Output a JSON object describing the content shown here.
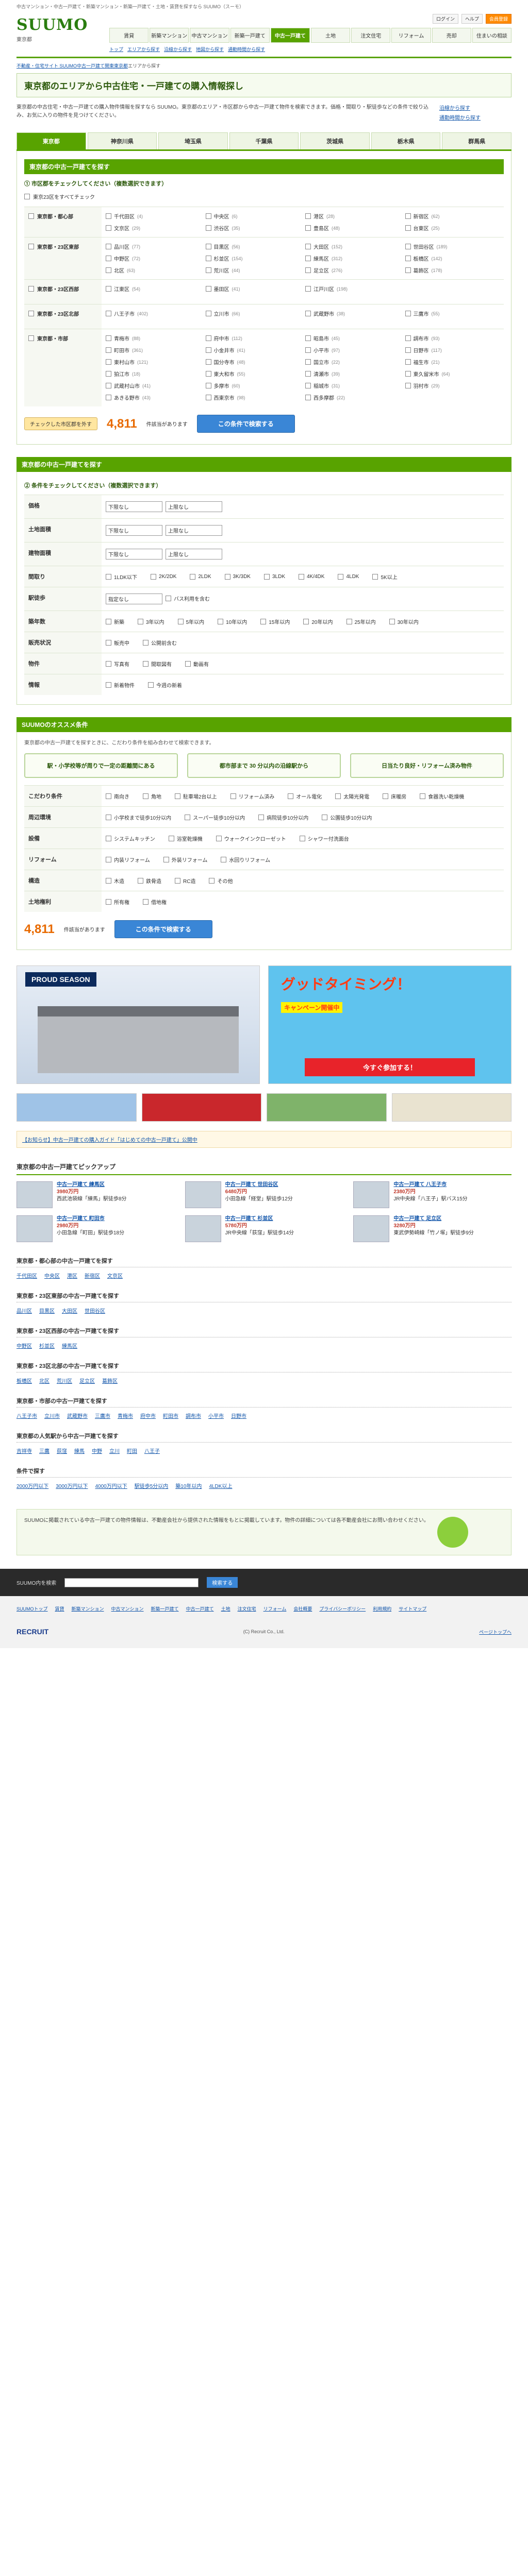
{
  "topline": "中古マンション・中古一戸建て・新築マンション・新築一戸建て・土地・賃貸を探すなら SUUMO（スーモ）",
  "logo": {
    "brand": "SUUMO",
    "sub": "東京都"
  },
  "util": [
    "ログイン",
    "ヘルプ",
    "会員登録"
  ],
  "gnav": [
    "賃貸",
    "新築マンション",
    "中古マンション",
    "新築一戸建て",
    "中古一戸建て",
    "土地",
    "注文住宅",
    "リフォーム",
    "売却",
    "住まいの相談"
  ],
  "gnav_active": 4,
  "subnav": [
    "トップ",
    "エリアから探す",
    "沿線から探す",
    "地図から探す",
    "通勤時間から探す"
  ],
  "breadcrumb": [
    "不動産・住宅サイト SUUMO",
    "中古一戸建て",
    "関東",
    "東京都",
    "エリアから探す"
  ],
  "title": "東京都のエリアから中古住宅・一戸建ての購入情報探し",
  "intro": "東京都の中古住宅・中古一戸建ての購入物件情報を探すなら SUUMO。東京都のエリア・市区郡から中古一戸建て物件を検索できます。価格・間取り・駅徒歩などの条件で絞り込み、お気に入りの物件を見つけてください。",
  "side_links": [
    "沿線から探す",
    "通勤時間から探す"
  ],
  "tabs": [
    "東京都",
    "神奈川県",
    "埼玉県",
    "千葉県",
    "茨城県",
    "栃木県",
    "群馬県"
  ],
  "area_head": "東京都の中古一戸建てを探す",
  "area_step": "① 市区郡をチェックしてください（複数選択できます）",
  "check_all": "東京23区をすべてチェック",
  "regions": [
    {
      "name": "東京都・都心部",
      "items": [
        [
          "千代田区",
          "(4)"
        ],
        [
          "中央区",
          "(6)"
        ],
        [
          "港区",
          "(28)"
        ],
        [
          "新宿区",
          "(62)"
        ],
        [
          "文京区",
          "(29)"
        ],
        [
          "渋谷区",
          "(35)"
        ],
        [
          "豊島区",
          "(48)"
        ],
        [
          "台東区",
          "(25)"
        ]
      ]
    },
    {
      "name": "東京都・23区東部",
      "items": [
        [
          "品川区",
          "(77)"
        ],
        [
          "目黒区",
          "(56)"
        ],
        [
          "大田区",
          "(152)"
        ],
        [
          "世田谷区",
          "(189)"
        ],
        [
          "中野区",
          "(72)"
        ],
        [
          "杉並区",
          "(154)"
        ],
        [
          "練馬区",
          "(312)"
        ],
        [
          "板橋区",
          "(142)"
        ],
        [
          "北区",
          "(63)"
        ],
        [
          "荒川区",
          "(44)"
        ],
        [
          "足立区",
          "(276)"
        ],
        [
          "葛飾区",
          "(178)"
        ]
      ]
    },
    {
      "name": "東京都・23区西部",
      "items": [
        [
          "江東区",
          "(54)"
        ],
        [
          "墨田区",
          "(41)"
        ],
        [
          "江戸川区",
          "(198)"
        ]
      ]
    },
    {
      "name": "東京都・23区北部",
      "items": [
        [
          "八王子市",
          "(402)"
        ],
        [
          "立川市",
          "(66)"
        ],
        [
          "武蔵野市",
          "(38)"
        ],
        [
          "三鷹市",
          "(55)"
        ]
      ]
    },
    {
      "name": "東京都・市部",
      "items": [
        [
          "青梅市",
          "(88)"
        ],
        [
          "府中市",
          "(112)"
        ],
        [
          "昭島市",
          "(45)"
        ],
        [
          "調布市",
          "(93)"
        ],
        [
          "町田市",
          "(361)"
        ],
        [
          "小金井市",
          "(41)"
        ],
        [
          "小平市",
          "(97)"
        ],
        [
          "日野市",
          "(117)"
        ],
        [
          "東村山市",
          "(121)"
        ],
        [
          "国分寺市",
          "(48)"
        ],
        [
          "国立市",
          "(22)"
        ],
        [
          "福生市",
          "(21)"
        ],
        [
          "狛江市",
          "(18)"
        ],
        [
          "東大和市",
          "(55)"
        ],
        [
          "清瀬市",
          "(39)"
        ],
        [
          "東久留米市",
          "(64)"
        ],
        [
          "武蔵村山市",
          "(41)"
        ],
        [
          "多摩市",
          "(60)"
        ],
        [
          "稲城市",
          "(31)"
        ],
        [
          "羽村市",
          "(29)"
        ],
        [
          "あきる野市",
          "(43)"
        ],
        [
          "西東京市",
          "(98)"
        ],
        [
          "西多摩郡",
          "(22)"
        ]
      ]
    }
  ],
  "count_all": "4,811",
  "count_label": "件該当があります",
  "search_btn": "この条件で検索する",
  "clear_btn": "チェックした市区郡を外す",
  "cond_head": "東京都の中古一戸建てを探す",
  "cond_step": "② 条件をチェックしてください（複数選択できます）",
  "conditions": [
    {
      "label": "価格",
      "selects": [
        "下限なし",
        "上限なし"
      ]
    },
    {
      "label": "土地面積",
      "selects": [
        "下限なし",
        "上限なし"
      ]
    },
    {
      "label": "建物面積",
      "selects": [
        "下限なし",
        "上限なし"
      ]
    },
    {
      "label": "間取り",
      "opts": [
        "1LDK以下",
        "2K/2DK",
        "2LDK",
        "3K/3DK",
        "3LDK",
        "4K/4DK",
        "4LDK",
        "5K以上"
      ]
    },
    {
      "label": "駅徒歩",
      "selects": [
        "指定なし"
      ],
      "opts": [
        "バス利用を含む"
      ]
    },
    {
      "label": "築年数",
      "opts": [
        "新築",
        "3年以内",
        "5年以内",
        "10年以内",
        "15年以内",
        "20年以内",
        "25年以内",
        "30年以内"
      ]
    },
    {
      "label": "販売状況",
      "opts": [
        "販売中",
        "公開前含む"
      ]
    },
    {
      "label": "物件",
      "opts": [
        "写真有",
        "間取図有",
        "動画有"
      ]
    },
    {
      "label": "情報",
      "opts": [
        "新着物件",
        "今週の新着"
      ]
    }
  ],
  "features_head": "SUUMOのオススメ条件",
  "features_note": "東京都の中古一戸建てを探すときに、こだわり条件を組み合わせて検索できます。",
  "features": [
    "駅・小学校等が周りで一定の距離間にある",
    "都市部まで 30 分以内の沿線駅から",
    "日当たり良好・リフォーム済み物件"
  ],
  "more_conditions": [
    {
      "label": "こだわり条件",
      "opts": [
        "南向き",
        "角地",
        "駐車場2台以上",
        "リフォーム済み",
        "オール電化",
        "太陽光発電",
        "床暖房",
        "食器洗い乾燥機"
      ]
    },
    {
      "label": "周辺環境",
      "opts": [
        "小学校まで徒歩10分以内",
        "スーパー徒歩10分以内",
        "病院徒歩10分以内",
        "公園徒歩10分以内"
      ]
    },
    {
      "label": "設備",
      "opts": [
        "システムキッチン",
        "浴室乾燥機",
        "ウォークインクローゼット",
        "シャワー付洗面台"
      ]
    },
    {
      "label": "リフォーム",
      "opts": [
        "内装リフォーム",
        "外装リフォーム",
        "水回りリフォーム"
      ]
    },
    {
      "label": "構造",
      "opts": [
        "木造",
        "鉄骨造",
        "RC造",
        "その他"
      ]
    },
    {
      "label": "土地権利",
      "opts": [
        "所有権",
        "借地権"
      ]
    }
  ],
  "banners": {
    "left": "PROUD SEASON",
    "right_t1": "グッドタイミング！",
    "right_t2": "キャンペーン開催中",
    "right_cta": "今すぐ参加する！"
  },
  "info": "【お知らせ】中古一戸建ての購入ガイド「はじめての中古一戸建て」公開中",
  "listings_head": "東京都の中古一戸建てピックアップ",
  "listings": [
    {
      "title": "中古一戸建て 練馬区",
      "price": "3980万円",
      "desc": "西武池袋線「練馬」駅徒歩8分"
    },
    {
      "title": "中古一戸建て 世田谷区",
      "price": "6480万円",
      "desc": "小田急線「経堂」駅徒歩12分"
    },
    {
      "title": "中古一戸建て 八王子市",
      "price": "2380万円",
      "desc": "JR中央線「八王子」駅バス15分"
    },
    {
      "title": "中古一戸建て 町田市",
      "price": "2980万円",
      "desc": "小田急線「町田」駅徒歩18分"
    },
    {
      "title": "中古一戸建て 杉並区",
      "price": "5780万円",
      "desc": "JR中央線「荻窪」駅徒歩14分"
    },
    {
      "title": "中古一戸建て 足立区",
      "price": "3280万円",
      "desc": "東武伊勢崎線「竹ノ塚」駅徒歩9分"
    }
  ],
  "link_blocks": [
    {
      "title": "東京都・都心部の中古一戸建てを探す",
      "links": [
        "千代田区",
        "中央区",
        "港区",
        "新宿区",
        "文京区"
      ]
    },
    {
      "title": "東京都・23区東部の中古一戸建てを探す",
      "links": [
        "品川区",
        "目黒区",
        "大田区",
        "世田谷区"
      ]
    },
    {
      "title": "東京都・23区西部の中古一戸建てを探す",
      "links": [
        "中野区",
        "杉並区",
        "練馬区"
      ]
    },
    {
      "title": "東京都・23区北部の中古一戸建てを探す",
      "links": [
        "板橋区",
        "北区",
        "荒川区",
        "足立区",
        "葛飾区"
      ]
    },
    {
      "title": "東京都・市部の中古一戸建てを探す",
      "links": [
        "八王子市",
        "立川市",
        "武蔵野市",
        "三鷹市",
        "青梅市",
        "府中市",
        "町田市",
        "調布市",
        "小平市",
        "日野市"
      ]
    },
    {
      "title": "東京都の人気駅から中古一戸建てを探す",
      "links": [
        "吉祥寺",
        "三鷹",
        "荻窪",
        "練馬",
        "中野",
        "立川",
        "町田",
        "八王子"
      ]
    },
    {
      "title": "条件で探す",
      "links": [
        "2000万円以下",
        "3000万円以下",
        "4000万円以下",
        "駅徒歩5分以内",
        "築10年以内",
        "4LDK以上"
      ]
    }
  ],
  "footer_note": "SUUMOに掲載されている中古一戸建ての物件情報は、不動産会社から提供された情報をもとに掲載しています。物件の詳細については各不動産会社にお問い合わせください。",
  "footer_search_label": "SUUMO内を検索",
  "footer_search_btn": "検索する",
  "footer_links": [
    "SUUMOトップ",
    "賃貸",
    "新築マンション",
    "中古マンション",
    "新築一戸建て",
    "中古一戸建て",
    "土地",
    "注文住宅",
    "リフォーム",
    "会社概要",
    "プライバシーポリシー",
    "利用規約",
    "サイトマップ"
  ],
  "recruit": "RECRUIT",
  "copyright": "(C) Recruit Co., Ltd.",
  "page_top": "ページトップへ"
}
